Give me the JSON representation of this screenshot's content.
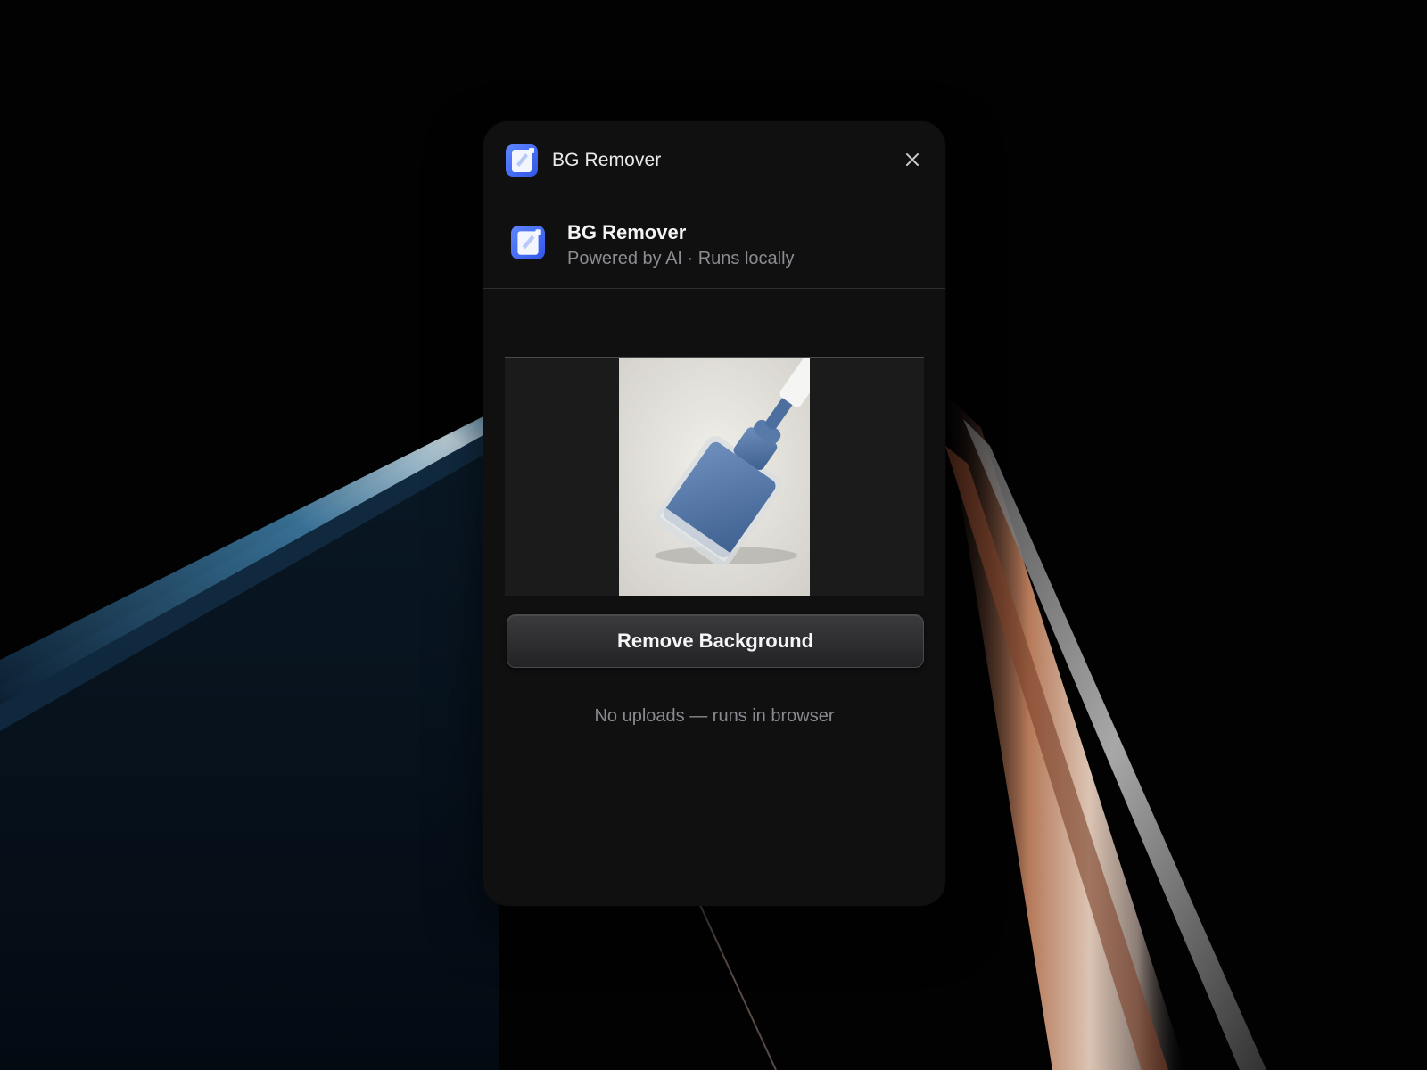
{
  "window": {
    "title": "BG Remover",
    "close_icon": "close-icon",
    "app_icon": "app-icon"
  },
  "header": {
    "app_name": "BG Remover",
    "subtitle": "Powered by AI · Runs locally"
  },
  "preview": {
    "image_subject": "blue nail polish bottle"
  },
  "actions": {
    "remove_label": "Remove Background"
  },
  "footer": {
    "note": "No uploads — runs in browser"
  },
  "colors": {
    "popup_bg": "#101011",
    "accent_blue": "#3f6ef6",
    "text_primary": "#f4f4f5",
    "text_muted": "#8c8c92"
  }
}
